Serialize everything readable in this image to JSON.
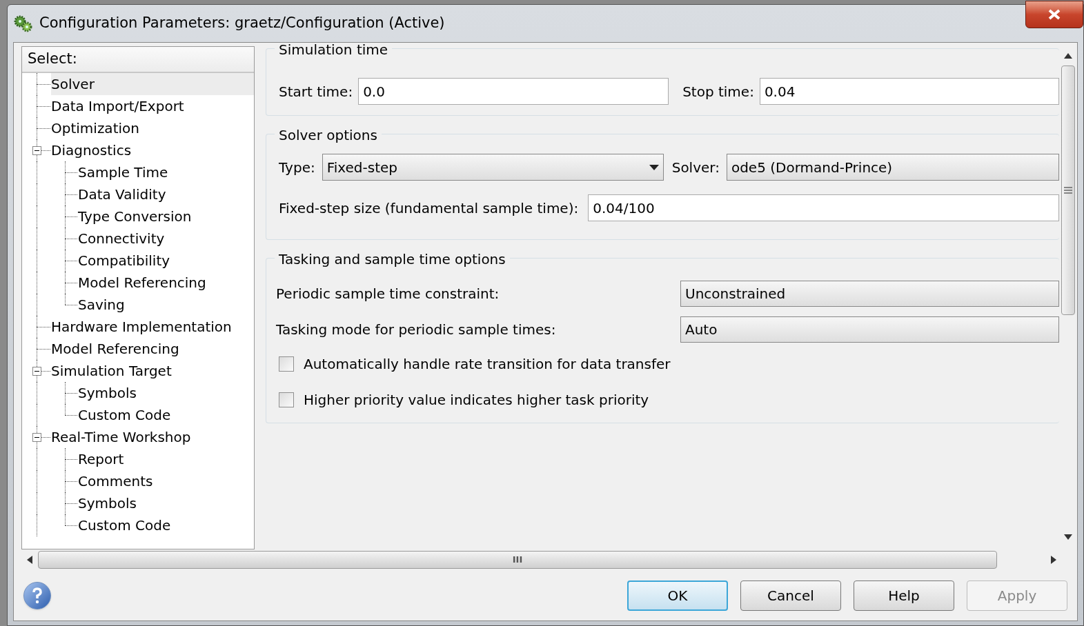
{
  "window": {
    "title": "Configuration Parameters: graetz/Configuration (Active)"
  },
  "tree": {
    "header": "Select:",
    "items": [
      {
        "label": "Solver",
        "selected": true
      },
      {
        "label": "Data Import/Export",
        "selected": false
      },
      {
        "label": "Optimization",
        "selected": false
      },
      {
        "label": "Diagnostics",
        "selected": false,
        "expanded": true,
        "children": [
          {
            "label": "Sample Time",
            "selected": false
          },
          {
            "label": "Data Validity",
            "selected": false
          },
          {
            "label": "Type Conversion",
            "selected": false
          },
          {
            "label": "Connectivity",
            "selected": false
          },
          {
            "label": "Compatibility",
            "selected": false
          },
          {
            "label": "Model Referencing",
            "selected": false
          },
          {
            "label": "Saving",
            "selected": false
          }
        ]
      },
      {
        "label": "Hardware Implementation",
        "selected": false
      },
      {
        "label": "Model Referencing",
        "selected": false
      },
      {
        "label": "Simulation Target",
        "selected": false,
        "expanded": true,
        "children": [
          {
            "label": "Symbols",
            "selected": false
          },
          {
            "label": "Custom Code",
            "selected": false
          }
        ]
      },
      {
        "label": "Real-Time Workshop",
        "selected": false,
        "expanded": true,
        "children": [
          {
            "label": "Report",
            "selected": false
          },
          {
            "label": "Comments",
            "selected": false
          },
          {
            "label": "Symbols",
            "selected": false
          },
          {
            "label": "Custom Code",
            "selected": false
          }
        ]
      }
    ]
  },
  "simulation_time": {
    "title": "Simulation time",
    "start_time": {
      "label": "Start time:",
      "value": "0.0"
    },
    "stop_time": {
      "label": "Stop time:",
      "value": "0.04"
    }
  },
  "solver_options": {
    "title": "Solver options",
    "type": {
      "label": "Type:",
      "value": "Fixed-step"
    },
    "solver": {
      "label": "Solver:",
      "value": "ode5 (Dormand-Prince)"
    },
    "fixed_step_size": {
      "label": "Fixed-step size (fundamental sample time):",
      "value": "0.04/100"
    }
  },
  "tasking": {
    "title": "Tasking and sample time options",
    "periodic_constraint": {
      "label": "Periodic sample time constraint:",
      "value": "Unconstrained"
    },
    "tasking_mode": {
      "label": "Tasking mode for periodic sample times:",
      "value": "Auto"
    },
    "checkboxes": [
      {
        "label": "Automatically handle rate transition for data transfer",
        "checked": false
      },
      {
        "label": "Higher priority value indicates higher task priority",
        "checked": false
      }
    ]
  },
  "scrollbar_grip": "III",
  "buttons": [
    {
      "label": "OK",
      "kind": "default"
    },
    {
      "label": "Cancel",
      "kind": "normal"
    },
    {
      "label": "Help",
      "kind": "normal"
    },
    {
      "label": "Apply",
      "kind": "disabled"
    }
  ]
}
